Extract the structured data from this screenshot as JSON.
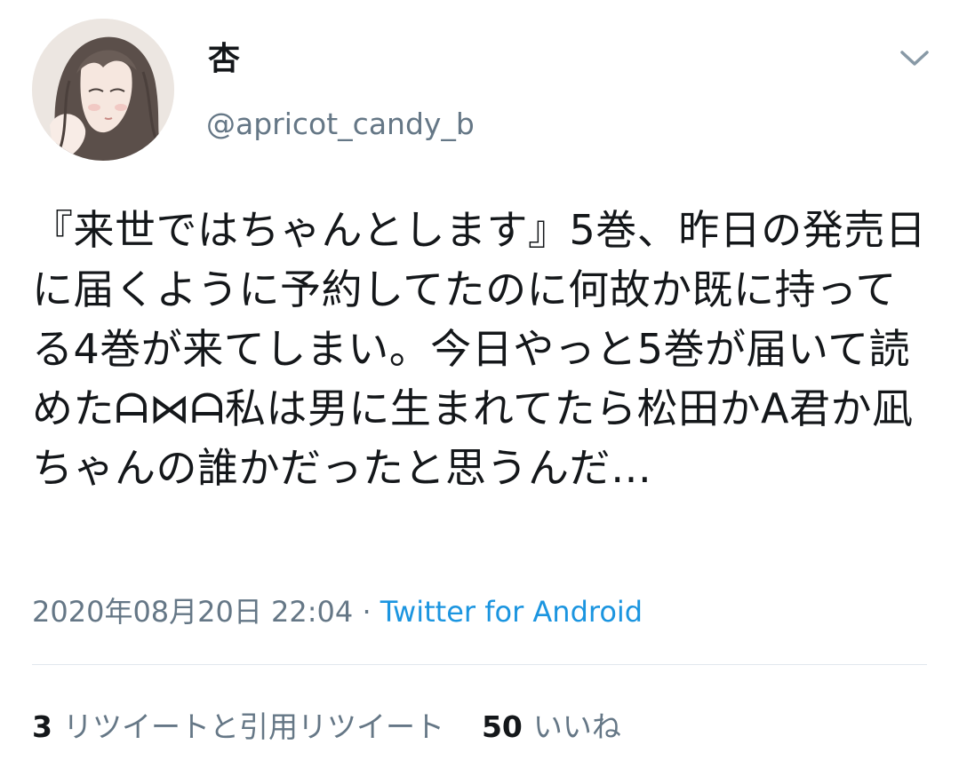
{
  "user": {
    "display_name": "杏",
    "handle": "@apricot_candy_b",
    "avatar_icon": "avatar-illustration-icon"
  },
  "tweet": {
    "text": "『来世ではちゃんとします』5巻、昨日の発売日に届くように予約してたのに何故か既に持ってる4巻が来てしまい。今日やっと5巻が届いて読めたᗩ⋈ᗩ私は男に生まれてたら松田かA君か凪ちゃんの誰かだったと思うんだ…",
    "timestamp": "2020年08月20日 22:04",
    "separator": "·",
    "source": "Twitter for Android"
  },
  "stats": {
    "retweets_count": "3",
    "retweets_label": "リツイートと引用リツイート",
    "likes_count": "50",
    "likes_label": "いいね"
  },
  "colors": {
    "text": "#14171a",
    "secondary": "#657786",
    "link": "#1b95e0",
    "divider": "#e1e8ed"
  }
}
